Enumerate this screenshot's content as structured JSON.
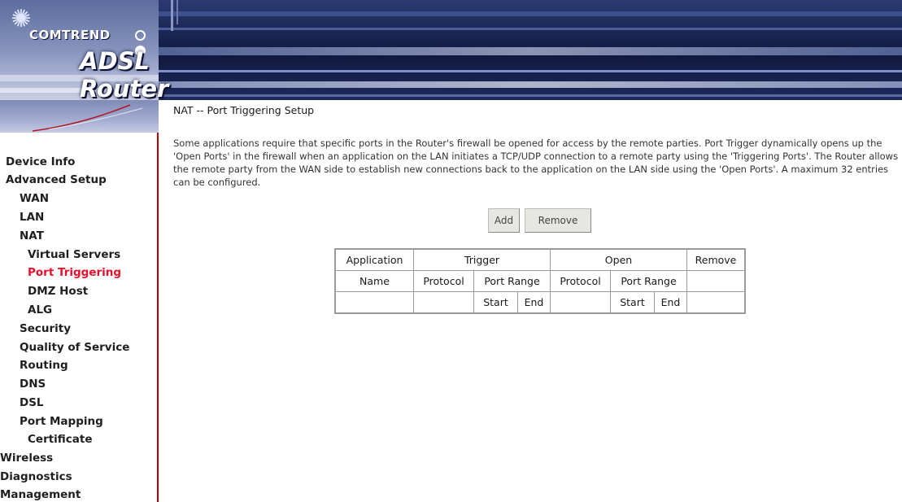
{
  "header": {
    "brand": "COMTREND",
    "product": "ADSL Router"
  },
  "sidebar": {
    "items": [
      {
        "label": "Device Info",
        "active": false
      },
      {
        "label": "Advanced Setup",
        "active": false
      },
      {
        "label": "WAN",
        "active": false
      },
      {
        "label": "LAN",
        "active": false
      },
      {
        "label": "NAT",
        "active": false
      },
      {
        "label": "Virtual Servers",
        "active": false
      },
      {
        "label": "Port Triggering",
        "active": true
      },
      {
        "label": "DMZ Host",
        "active": false
      },
      {
        "label": "ALG",
        "active": false
      },
      {
        "label": "Security",
        "active": false
      },
      {
        "label": "Quality of Service",
        "active": false
      },
      {
        "label": "Routing",
        "active": false
      },
      {
        "label": "DNS",
        "active": false
      },
      {
        "label": "DSL",
        "active": false
      },
      {
        "label": "Port Mapping",
        "active": false
      },
      {
        "label": "Certificate",
        "active": false
      },
      {
        "label": "Wireless",
        "active": false
      },
      {
        "label": "Diagnostics",
        "active": false
      },
      {
        "label": "Management",
        "active": false
      }
    ]
  },
  "main": {
    "title": "NAT -- Port Triggering Setup",
    "description": "Some applications require that specific ports in the Router's firewall be opened for access by the remote parties. Port Trigger dynamically opens up the 'Open Ports' in the firewall when an application on the LAN initiates a TCP/UDP connection to a remote party using the 'Triggering Ports'. The Router allows the remote party from the WAN side to establish new connections back to the application on the LAN side using the 'Open Ports'. A maximum 32 entries can be configured.",
    "add_label": "Add",
    "remove_label": "Remove"
  },
  "table": {
    "row1": {
      "application": "Application",
      "trigger": "Trigger",
      "open": "Open",
      "remove": "Remove"
    },
    "row2": {
      "name": "Name",
      "trigger_protocol": "Protocol",
      "trigger_port_range": "Port Range",
      "open_protocol": "Protocol",
      "open_port_range": "Port Range"
    },
    "row3": {
      "trigger_start": "Start",
      "trigger_end": "End",
      "open_start": "Start",
      "open_end": "End"
    }
  },
  "colors": {
    "active_nav": "#e8102a",
    "sidebar_border": "#c00000",
    "banner_dark": "#10193f"
  }
}
